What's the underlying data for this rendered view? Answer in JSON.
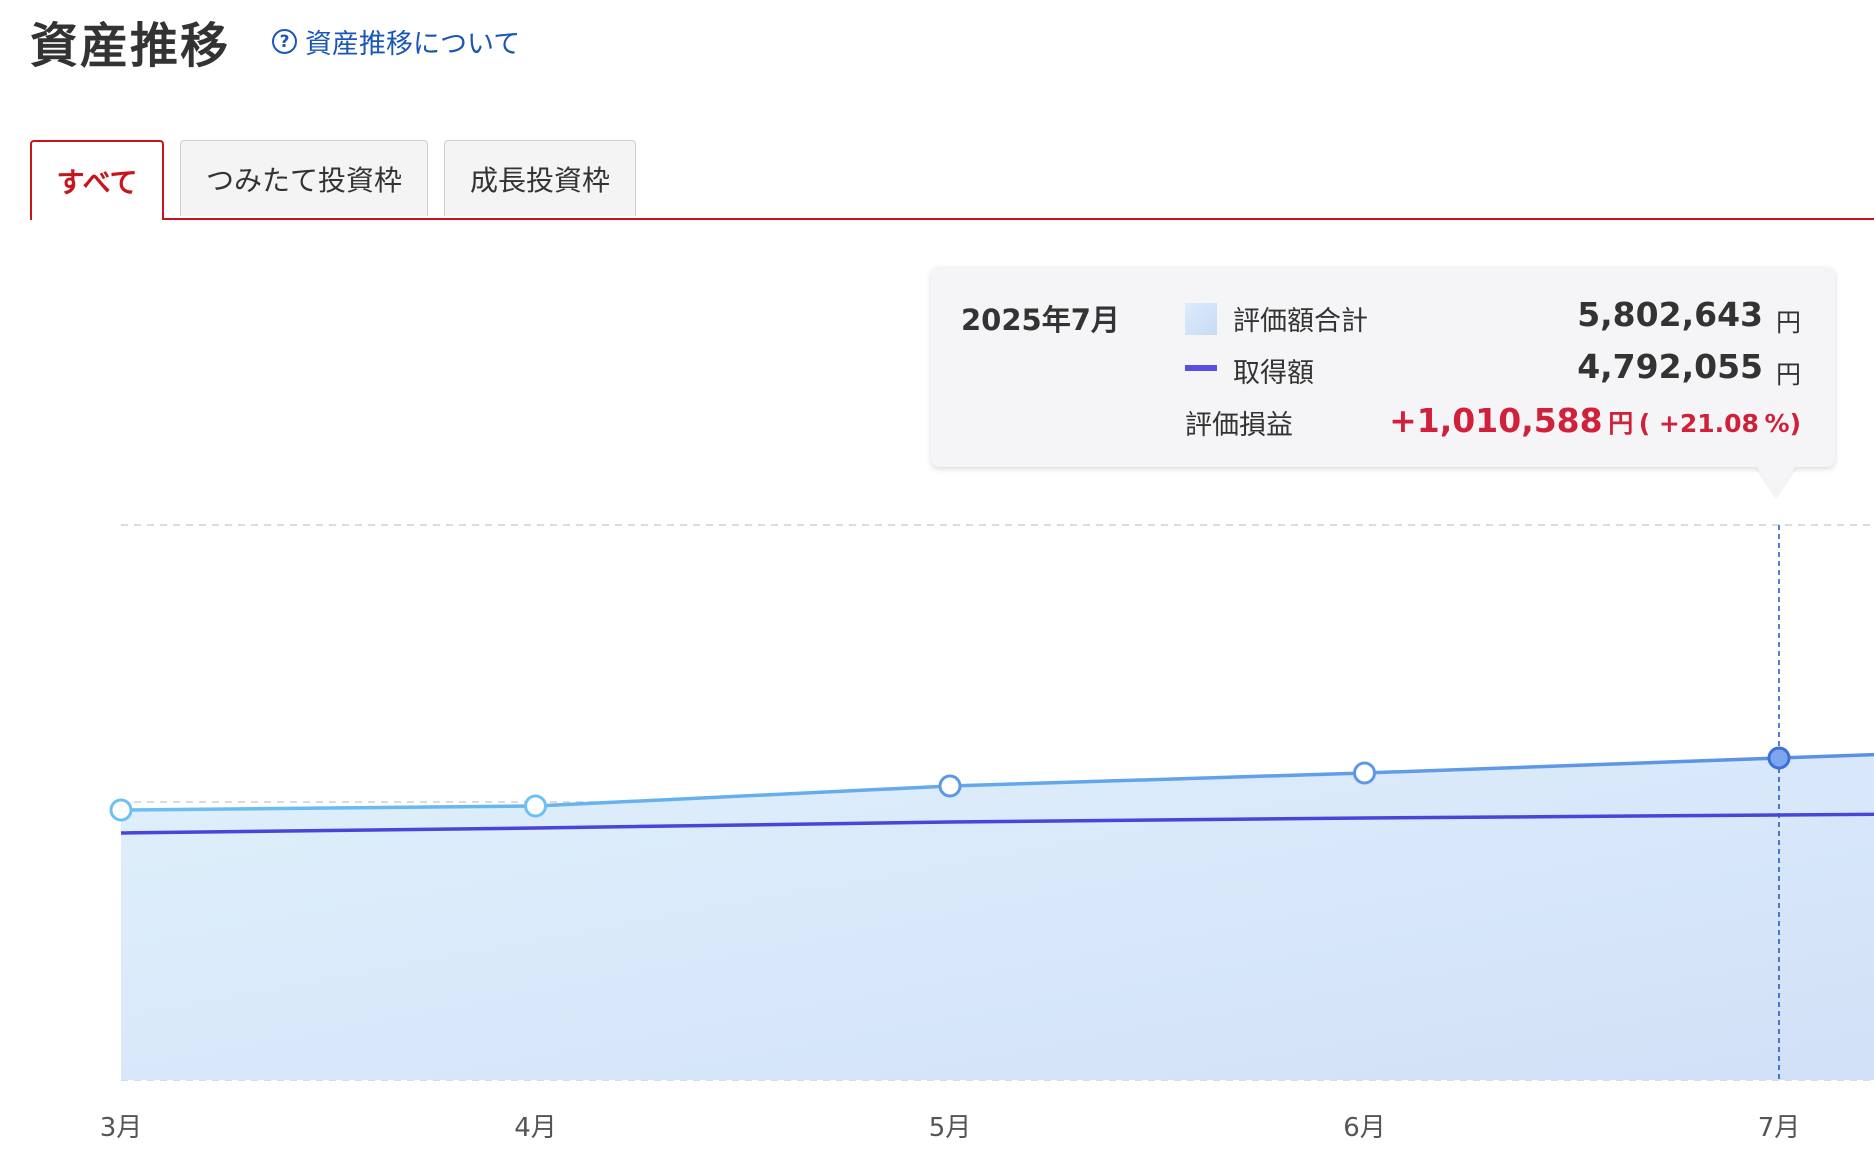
{
  "header": {
    "title": "資産推移",
    "help_link": "資産推移について",
    "help_icon": "?"
  },
  "tabs": [
    {
      "label": "すべて",
      "active": true
    },
    {
      "label": "つみたて投資枠",
      "active": false
    },
    {
      "label": "成長投資枠",
      "active": false
    }
  ],
  "tooltip": {
    "date": "2025年7月",
    "rows": [
      {
        "label": "評価額合計",
        "value": "5,802,643",
        "unit": "円"
      },
      {
        "label": "取得額",
        "value": "4,792,055",
        "unit": "円"
      }
    ],
    "pl": {
      "label": "評価損益",
      "value": "+1,010,588",
      "unit": "円",
      "percent_open": "( +21.08",
      "percent_close": "%)"
    }
  },
  "colors": {
    "accent": "#c8151c",
    "link": "#1a56b8",
    "valuation_line": "#5aa3ea",
    "acquisition_line": "#4a45d8",
    "area_fill_start": "#dff0fb",
    "area_fill_end": "#d2e0f8",
    "profit_red": "#d0213a"
  },
  "chart_data": {
    "type": "area",
    "categories": [
      "3月",
      "4月",
      "5月",
      "6月",
      "7月"
    ],
    "series": [
      {
        "name": "評価額合計",
        "values": [
          5450000,
          5470000,
          5570000,
          5640000,
          5802643
        ]
      },
      {
        "name": "取得額",
        "values": [
          5320000,
          5350000,
          5380000,
          5400000,
          4792055
        ]
      }
    ],
    "selected_index": 4
  }
}
